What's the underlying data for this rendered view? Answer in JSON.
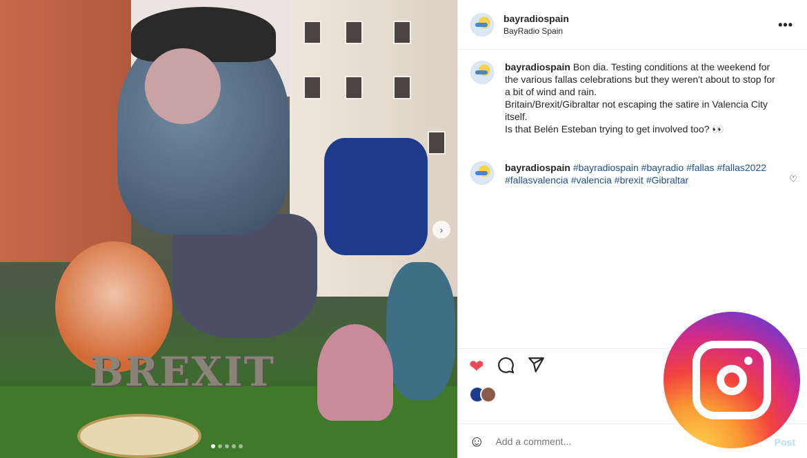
{
  "media": {
    "sign_text": "BREXIT",
    "next_arrow": "›",
    "slide_count": 5,
    "current_slide": 1
  },
  "header": {
    "username": "bayradiospain",
    "subtitle": "BayRadio Spain",
    "more_label": "•••"
  },
  "caption": {
    "username": "bayradiospain",
    "lines": [
      "Bon dia. Testing conditions at the weekend for the various fallas celebrations but they weren't about to stop for a bit of wind and rain.",
      "Britain/Brexit/Gibraltar not escaping the satire in Valencia City itself.",
      "Is that Belén Esteban trying to get involved too? 👀"
    ]
  },
  "hashtag_comment": {
    "username": "bayradiospain",
    "tags": [
      "#bayradiospain",
      "#bayradio",
      "#fallas",
      "#fallas2022",
      "#fallasvalencia",
      "#valencia",
      "#brexit",
      "#Gibraltar"
    ]
  },
  "actions": {
    "like_icon": "heart-filled-icon",
    "comment_icon": "comment-icon",
    "share_icon": "share-icon",
    "like_color": "#ed4956"
  },
  "add_comment": {
    "placeholder": "Add a comment...",
    "post_label": "Post"
  },
  "colors": {
    "hashtag": "#1d4f8c",
    "post_disabled": "#b2dffc"
  }
}
